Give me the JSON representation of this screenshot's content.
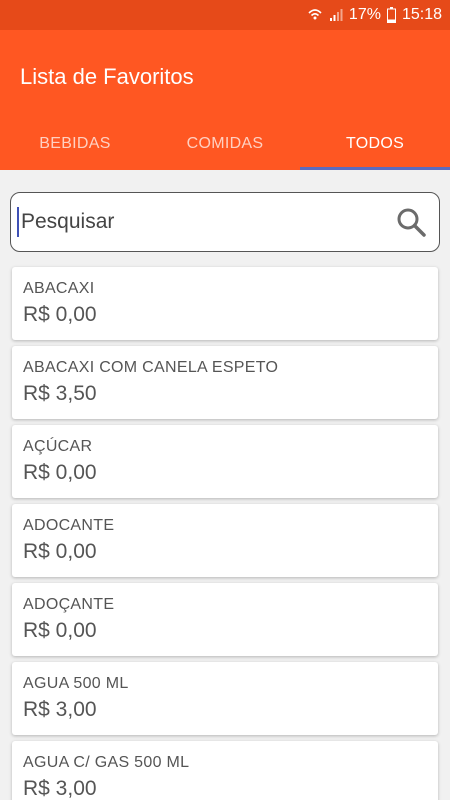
{
  "status": {
    "battery": "17%",
    "time": "15:18"
  },
  "app": {
    "title": "Lista de Favoritos"
  },
  "tabs": [
    {
      "label": "BEBIDAS"
    },
    {
      "label": "COMIDAS"
    },
    {
      "label": "TODOS"
    }
  ],
  "search": {
    "placeholder": "Pesquisar"
  },
  "items": [
    {
      "name": "ABACAXI",
      "price": "R$ 0,00"
    },
    {
      "name": "ABACAXI COM CANELA ESPETO",
      "price": "R$ 3,50"
    },
    {
      "name": "AÇÚCAR",
      "price": "R$ 0,00"
    },
    {
      "name": "ADOCANTE",
      "price": "R$ 0,00"
    },
    {
      "name": "ADOÇANTE",
      "price": "R$ 0,00"
    },
    {
      "name": "AGUA 500 ML",
      "price": "R$ 3,00"
    },
    {
      "name": "AGUA C/ GAS 500 ML",
      "price": "R$ 3,00"
    }
  ],
  "colors": {
    "status_bar": "#e64a19",
    "app_bar": "#ff5722",
    "tab_indicator": "#5c6bc0"
  }
}
